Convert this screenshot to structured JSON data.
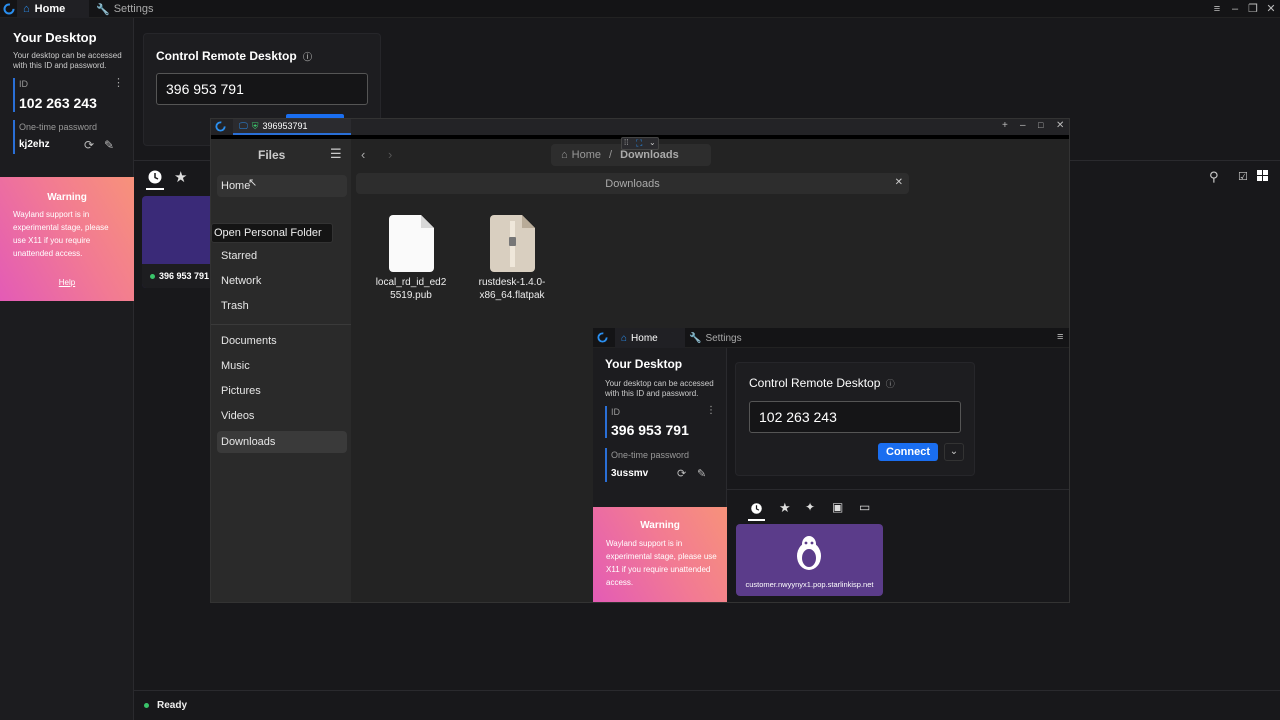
{
  "app": {
    "tabs": [
      {
        "label": "Home"
      },
      {
        "label": "Settings"
      }
    ]
  },
  "left": {
    "title": "Your Desktop",
    "subtitle": "Your desktop can be accessed with this ID and password.",
    "id_label": "ID",
    "id_value": "102 263 243",
    "otp_label": "One-time password",
    "otp_value": "kj2ehz"
  },
  "warning": {
    "title": "Warning",
    "text": "Wayland support is in experimental stage, please use X11 if you require unattended access.",
    "help": "Help"
  },
  "control": {
    "title": "Control Remote Desktop",
    "id_value": "396 953 791"
  },
  "recent": {
    "peer_id": "396 953 791"
  },
  "status": {
    "text": "Ready"
  },
  "remote": {
    "tab_label": "396953791",
    "files": {
      "title": "Files",
      "tooltip": "Open Personal Folder",
      "nav": [
        {
          "label": "Home"
        },
        {
          "label": "Starred"
        },
        {
          "label": "Network"
        },
        {
          "label": "Trash"
        },
        {
          "label": "Documents"
        },
        {
          "label": "Music"
        },
        {
          "label": "Pictures"
        },
        {
          "label": "Videos"
        },
        {
          "label": "Downloads"
        }
      ],
      "breadcrumb": {
        "home": "Home",
        "current": "Downloads"
      },
      "search_value": "Downloads",
      "items": [
        {
          "name_line1": "local_rd_id_ed2",
          "name_line2": "5519.pub"
        },
        {
          "name_line1": "rustdesk-1.4.0-",
          "name_line2": "x86_64.flatpak"
        }
      ]
    },
    "nested": {
      "tabs": [
        {
          "label": "Home"
        },
        {
          "label": "Settings"
        }
      ],
      "title": "Your Desktop",
      "subtitle": "Your desktop can be accessed with this ID and password.",
      "id_label": "ID",
      "id_value": "396 953 791",
      "otp_label": "One-time password",
      "otp_value": "3ussmv",
      "control_title": "Control Remote Desktop",
      "control_id": "102 263 243",
      "connect": "Connect",
      "warning_title": "Warning",
      "warning_text": "Wayland support is in experimental stage, please use X11 if you require unattended access.",
      "peer_host": "customer.nwyynyx1.pop.starlinkisp.net"
    }
  }
}
